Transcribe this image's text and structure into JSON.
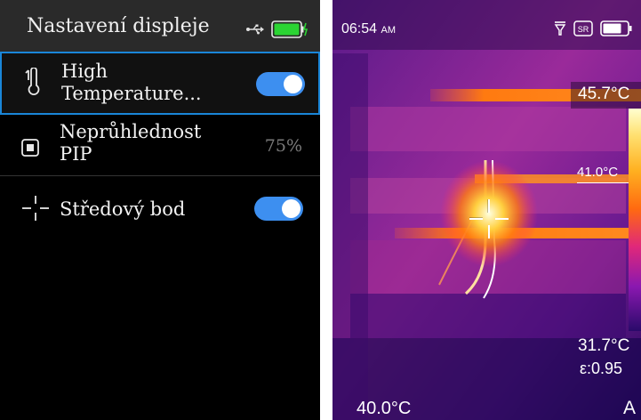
{
  "settings": {
    "title": "Nastavení displeje",
    "icons": {
      "usb": "usb-icon",
      "battery": "battery-full-icon",
      "high_temp": "thermometer-icon",
      "pip": "pip-square-icon",
      "center": "crosshair-icon"
    },
    "items": [
      {
        "label": "High\nTemperature...",
        "toggle_on": true,
        "selected": true
      },
      {
        "label": "Neprůhlednost\nPIP",
        "value": "75%"
      },
      {
        "label": "Středový bod",
        "toggle_on": true
      }
    ],
    "colors": {
      "background": "#000000",
      "header": "#2a2a2a",
      "selection_border": "#1a86d8",
      "toggle_on": "#3d8ff0",
      "battery": "#2bd433"
    }
  },
  "thermal": {
    "time": "06:54",
    "time_suffix": "AM",
    "status_icons": [
      "filter-icon",
      "sr-icon",
      "battery-icon"
    ],
    "sr_label": "SR",
    "max_temp": "45.7°C",
    "marker_temp": "41.0°C",
    "min_temp": "31.7°C",
    "emissivity": "ε:0.95",
    "center_temp": "40.0°C",
    "mode": "A",
    "palette": "ironbow"
  }
}
